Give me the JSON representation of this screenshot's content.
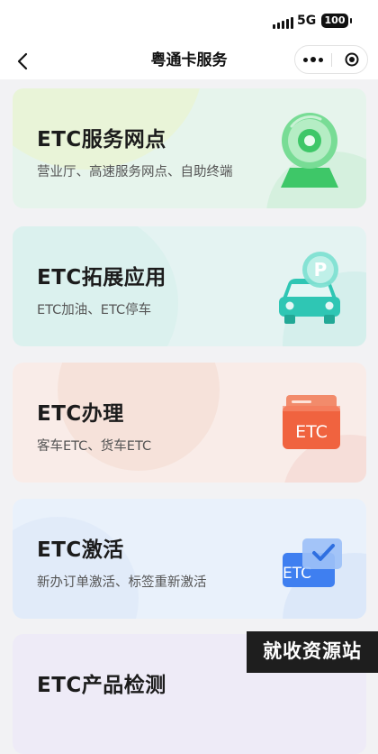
{
  "status_bar": {
    "network": "5G",
    "battery": "100"
  },
  "nav": {
    "title": "粤通卡服务"
  },
  "cards": [
    {
      "title": "ETC服务网点",
      "subtitle": "营业厅、高速服务网点、自助终端"
    },
    {
      "title": "ETC拓展应用",
      "subtitle": "ETC加油、ETC停车"
    },
    {
      "title": "ETC办理",
      "subtitle": "客车ETC、货车ETC",
      "icon_text": "ETC"
    },
    {
      "title": "ETC激活",
      "subtitle": "新办订单激活、标签重新激活",
      "icon_text": "ETC"
    },
    {
      "title": "ETC产品检测"
    }
  ],
  "watermark": "就收资源站",
  "colors": {
    "card_green": "#e6f4ec",
    "card_teal": "#e4f3f2",
    "card_orange": "#f9ece8",
    "card_blue": "#e9f1fb",
    "card_purple": "#eeebf7",
    "icon_green": "#3ec768",
    "icon_teal": "#2fc6b4",
    "icon_orange": "#f0633f",
    "icon_blue": "#3f7ff0"
  },
  "icons": {
    "back": "chevron-left-icon",
    "more": "more-dots-icon",
    "close": "target-circle-icon",
    "card1": "location-pin-icon",
    "card2": "car-parking-icon",
    "card3": "etc-card-icon",
    "card4": "etc-activate-icon"
  }
}
